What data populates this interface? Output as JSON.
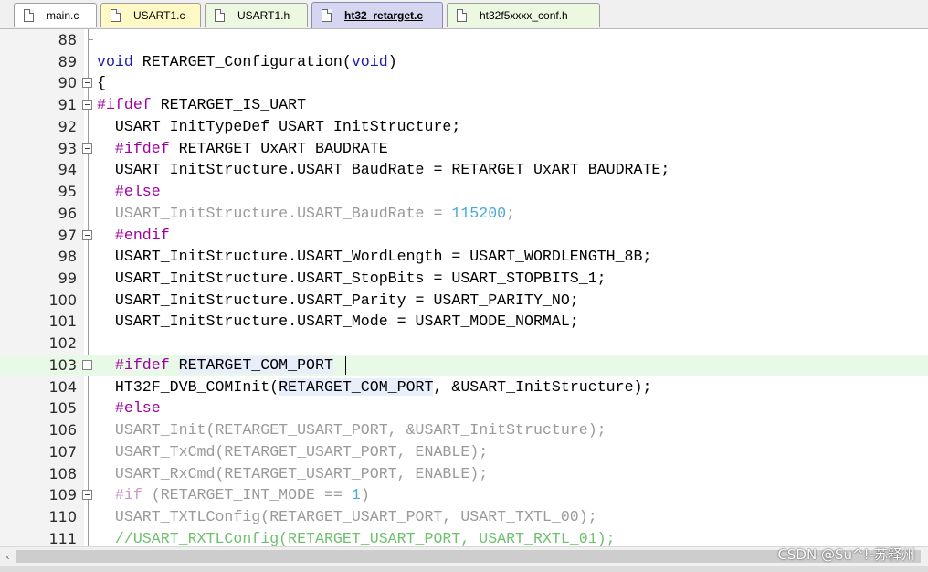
{
  "tabs": [
    {
      "label": "main.c",
      "color": "white"
    },
    {
      "label": "USART1.c",
      "color": "yellow"
    },
    {
      "label": "USART1.h",
      "color": "green"
    },
    {
      "label": "ht32_retarget.c",
      "color": "active"
    },
    {
      "label": "ht32f5xxxx_conf.h",
      "color": "green"
    }
  ],
  "lines": [
    {
      "num": "88",
      "text": ""
    },
    {
      "num": "89",
      "text": "void RETARGET_Configuration(void)"
    },
    {
      "num": "90",
      "text": "{"
    },
    {
      "num": "91",
      "text": "#ifdef RETARGET_IS_UART"
    },
    {
      "num": "92",
      "text": "  USART_InitTypeDef USART_InitStructure;"
    },
    {
      "num": "93",
      "text": "  #ifdef RETARGET_UxART_BAUDRATE"
    },
    {
      "num": "94",
      "text": "  USART_InitStructure.USART_BaudRate = RETARGET_UxART_BAUDRATE;"
    },
    {
      "num": "95",
      "text": "  #else"
    },
    {
      "num": "96",
      "text": "  USART_InitStructure.USART_BaudRate = 115200;"
    },
    {
      "num": "97",
      "text": "  #endif"
    },
    {
      "num": "98",
      "text": "  USART_InitStructure.USART_WordLength = USART_WORDLENGTH_8B;"
    },
    {
      "num": "99",
      "text": "  USART_InitStructure.USART_StopBits = USART_STOPBITS_1;"
    },
    {
      "num": "100",
      "text": "  USART_InitStructure.USART_Parity = USART_PARITY_NO;"
    },
    {
      "num": "101",
      "text": "  USART_InitStructure.USART_Mode = USART_MODE_NORMAL;"
    },
    {
      "num": "102",
      "text": ""
    },
    {
      "num": "103",
      "text": "  #ifdef RETARGET_COM_PORT"
    },
    {
      "num": "104",
      "text": "  HT32F_DVB_COMInit(RETARGET_COM_PORT, &USART_InitStructure);"
    },
    {
      "num": "105",
      "text": "  #else"
    },
    {
      "num": "106",
      "text": "  USART_Init(RETARGET_USART_PORT, &USART_InitStructure);"
    },
    {
      "num": "107",
      "text": "  USART_TxCmd(RETARGET_USART_PORT, ENABLE);"
    },
    {
      "num": "108",
      "text": "  USART_RxCmd(RETARGET_USART_PORT, ENABLE);"
    },
    {
      "num": "109",
      "text": "  #if (RETARGET_INT_MODE == 1)"
    },
    {
      "num": "110",
      "text": "  USART_TXTLConfig(RETARGET_USART_PORT, USART_TXTL_00);"
    },
    {
      "num": "111",
      "text": "  //USART_RXTLConfig(RETARGET_USART_PORT, USART_RXTL_01);"
    }
  ],
  "watermark": "CSDN @Su^!-苏释州",
  "scroll_left_arrow": "‹",
  "colors": {
    "keyword": "#1c1cb0",
    "preprocessor": "#a000a0",
    "inactive_code": "#9a9a9a",
    "number": "#4aa9d6",
    "comment": "#6fc06f",
    "current_line": "#e8f9e8",
    "active_tab": "#d6d6f0"
  }
}
